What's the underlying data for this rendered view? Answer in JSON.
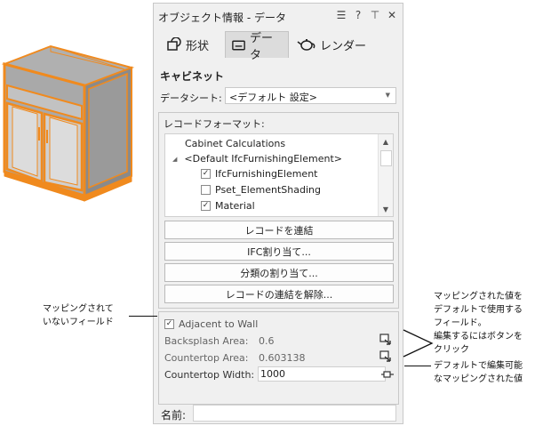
{
  "palette": {
    "title": "オブジェクト情報 - データ",
    "titlebar_icons": [
      "menu-icon",
      "help-icon",
      "pin-icon",
      "close-icon"
    ],
    "tabs": [
      {
        "label": "形状",
        "icon": "shape-icon"
      },
      {
        "label": "データ",
        "icon": "data-icon",
        "active": true
      },
      {
        "label": "レンダー",
        "icon": "teapot-icon"
      }
    ],
    "object_type": "キャビネット",
    "datasheet": {
      "label": "データシート:",
      "value": "<デフォルト 設定>"
    },
    "record_format": {
      "label": "レコードフォーマット:",
      "items": [
        {
          "label": "Cabinet Calculations",
          "checked": null
        },
        {
          "label": "<Default IfcFurnishingElement>",
          "checked": null,
          "expandable": true
        },
        {
          "label": "IfcFurnishingElement",
          "checked": true
        },
        {
          "label": "Pset_ElementShading",
          "checked": false
        },
        {
          "label": "Material",
          "checked": true
        }
      ]
    },
    "buttons": {
      "attach": "レコードを連結",
      "ifc_assign": "IFC割り当て...",
      "classify": "分類の割り当て...",
      "detach": "レコードの連結を解除..."
    },
    "fields": {
      "adjacent": {
        "label": "Adjacent to Wall",
        "checked": true
      },
      "backsplash": {
        "label": "Backsplash Area:",
        "value": "0.6"
      },
      "countertop_area": {
        "label": "Countertop Area:",
        "value": "0.603138"
      },
      "countertop_width": {
        "label": "Countertop Width:",
        "value": "1000"
      }
    },
    "name_label": "名前:",
    "name_value": ""
  },
  "annotations": {
    "unmapped": "マッピングされて\nいないフィールド",
    "mapped": "マッピングされた値を\nデフォルトで使用する\nフィールド。\n編集するにはボタンを\nクリック",
    "editable": "デフォルトで編集可能\nなマッピングされた値"
  },
  "colors": {
    "cabinet_edge": "#f08a1e",
    "panel_bg": "#f0f0f0"
  }
}
